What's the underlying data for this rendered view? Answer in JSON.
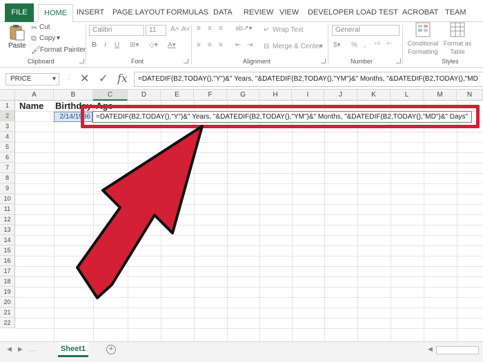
{
  "ribbon": {
    "tabs": [
      "FILE",
      "HOME",
      "INSERT",
      "PAGE LAYOUT",
      "FORMULAS",
      "DATA",
      "REVIEW",
      "VIEW",
      "DEVELOPER",
      "LOAD TEST",
      "ACROBAT",
      "TEAM"
    ],
    "active_tab": "HOME",
    "clipboard": {
      "paste": "Paste",
      "cut": "Cut",
      "copy": "Copy",
      "format_painter": "Format Painter",
      "label": "Clipboard"
    },
    "font": {
      "name": "Calibri",
      "size": "11",
      "label": "Font"
    },
    "alignment": {
      "wrap_text": "Wrap Text",
      "merge": "Merge & Center",
      "label": "Alignment"
    },
    "number": {
      "format": "General",
      "label": "Number"
    },
    "styles": {
      "conditional": "Conditional Formatting",
      "format_table": "Format as Table",
      "label": "Styles"
    }
  },
  "formula_bar": {
    "name_box": "PRICE",
    "formula": "=DATEDIF(B2,TODAY(),\"Y\")&\" Years, \"&DATEDIF(B2,TODAY(),\"YM\")&\" Months, \"&DATEDIF(B2,TODAY(),\"MD"
  },
  "sheet": {
    "columns": [
      "A",
      "B",
      "C",
      "D",
      "E",
      "F",
      "G",
      "H",
      "I",
      "J",
      "K",
      "L",
      "M",
      "N"
    ],
    "selected_column": "C",
    "rows": [
      "1",
      "2",
      "3",
      "4",
      "5",
      "6",
      "7",
      "8",
      "9",
      "10",
      "11",
      "12",
      "13",
      "14",
      "15",
      "16",
      "17",
      "18",
      "19",
      "20",
      "21",
      "22"
    ],
    "selected_row": "2",
    "A1": "Name",
    "B1": "Birthday",
    "C1": "Age",
    "B2": "2/14/1986",
    "C2_edit": "=DATEDIF(B2,TODAY(),\"Y\")&\" Years, \"&DATEDIF(B2,TODAY(),\"YM\")&\" Months, \"&DATEDIF(B2,TODAY(),\"MD\")&\" Days\""
  },
  "sheet_tabs": {
    "active": "Sheet1"
  },
  "colors": {
    "excel_green": "#217346",
    "annotation_red": "#d32035",
    "ref_blue": "#4472c4"
  }
}
